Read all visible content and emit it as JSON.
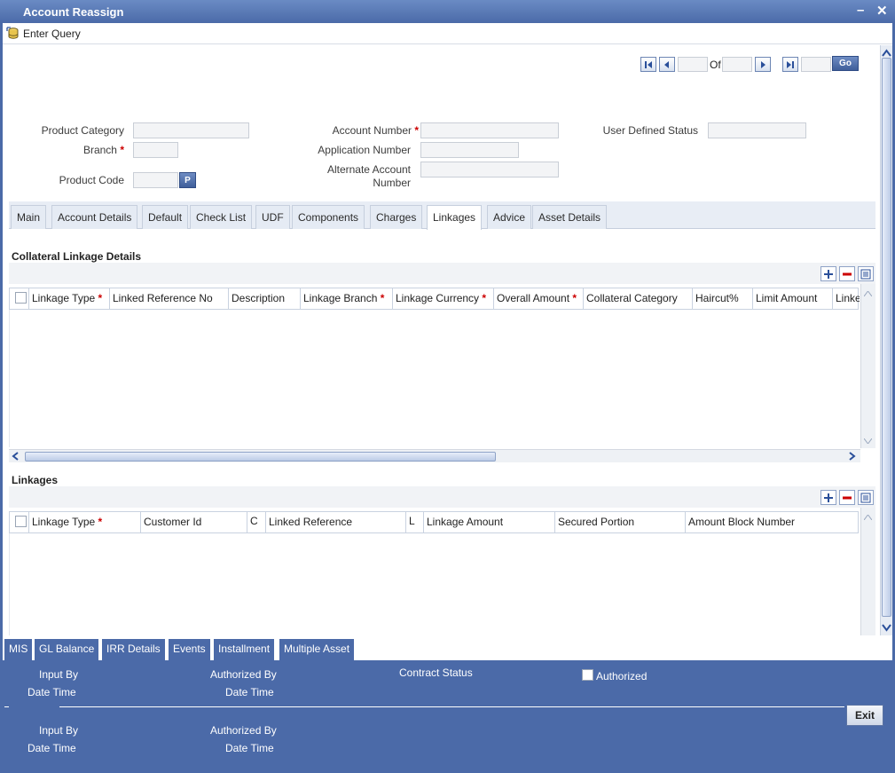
{
  "window": {
    "title": "Account Reassign",
    "minimize": "–",
    "close": "✕"
  },
  "toolbar": {
    "enter_query": "Enter Query"
  },
  "nav": {
    "of_label": "Of",
    "go_label": "Go",
    "current": "",
    "total": ""
  },
  "form": {
    "product_category_label": "Product Category",
    "branch_label": "Branch",
    "product_code_label": "Product Code",
    "product_code_btn": "P",
    "account_number_label": "Account Number",
    "application_number_label": "Application Number",
    "alternate_account_label_line1": "Alternate Account",
    "alternate_account_label_line2": "Number",
    "user_defined_status_label": "User Defined Status",
    "required_mark": "*"
  },
  "tabs": [
    "Main",
    "Account Details",
    "Default",
    "Check List",
    "UDF",
    "Components",
    "Charges",
    "Linkages",
    "Advice",
    "Asset Details"
  ],
  "active_tab": "Linkages",
  "collateral": {
    "title": "Collateral Linkage Details",
    "columns": [
      "Linkage Type",
      "Linked Reference No",
      "Description",
      "Linkage Branch",
      "Linkage Currency",
      "Overall Amount",
      "Collateral Category",
      "Haircut%",
      "Limit Amount",
      "Linke"
    ]
  },
  "linkages": {
    "title": "Linkages",
    "columns": [
      "Linkage Type",
      "Customer Id",
      "C",
      "Linked Reference",
      "L",
      "Linkage Amount",
      "Secured Portion",
      "Amount Block Number"
    ]
  },
  "bottom_tabs": [
    "MIS",
    "GL Balance",
    "IRR Details",
    "Events",
    "Installment",
    "Multiple Asset"
  ],
  "footer": {
    "input_by": "Input By",
    "date_time": "Date Time",
    "authorized_by": "Authorized By",
    "contract_status": "Contract Status",
    "authorized": "Authorized",
    "exit": "Exit"
  },
  "colors": {
    "brand": "#4b6aa8",
    "required": "#cc0000"
  }
}
